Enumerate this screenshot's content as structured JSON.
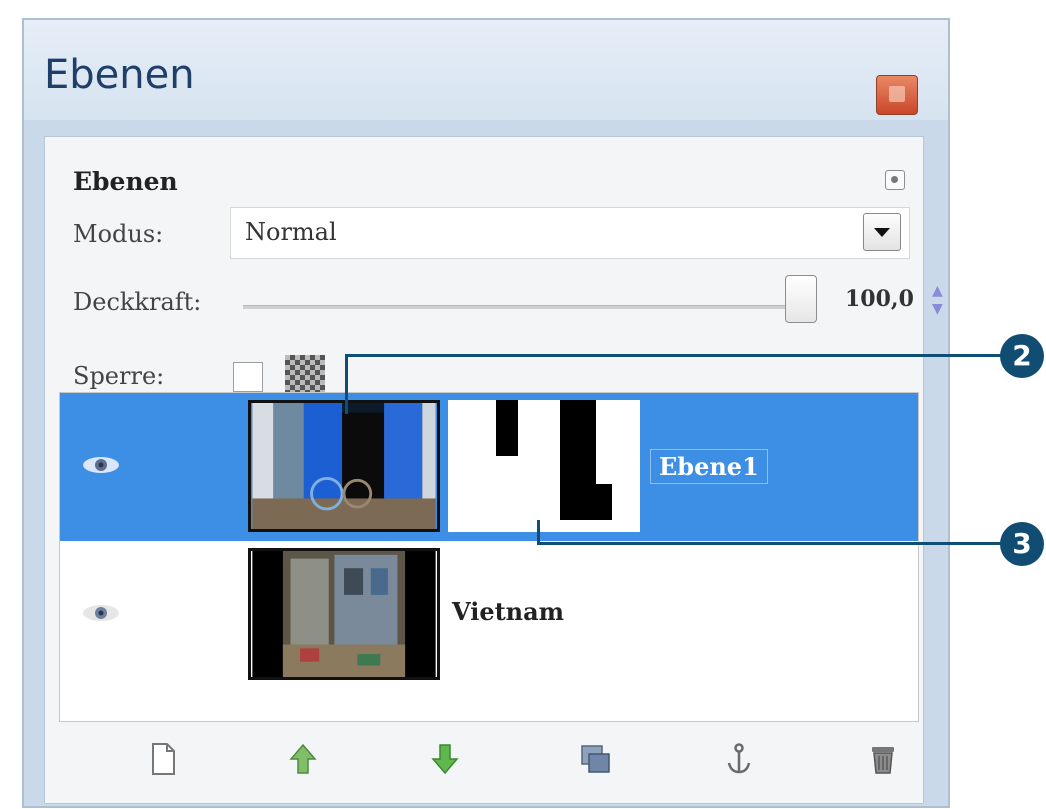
{
  "window": {
    "title": "Ebenen"
  },
  "panel": {
    "heading": "Ebenen",
    "mode_label": "Modus:",
    "mode_value": "Normal",
    "opacity_label": "Deckkraft:",
    "opacity_value": "100,0",
    "opacity_percent": 100,
    "lock_label": "Sperre:"
  },
  "layers": [
    {
      "name": "Ebene1",
      "selected": true,
      "has_mask": true,
      "visible": true
    },
    {
      "name": "Vietnam",
      "selected": false,
      "has_mask": false,
      "visible": true
    }
  ],
  "footer_icons": [
    "new-layer-icon",
    "raise-layer-icon",
    "lower-layer-icon",
    "duplicate-layer-icon",
    "anchor-layer-icon",
    "delete-layer-icon"
  ],
  "callouts": [
    "2",
    "3"
  ],
  "colors": {
    "selection": "#3d8fe6",
    "window_frame": "#c9d9ea",
    "callout": "#114d73",
    "raise_arrow": "#7fbf6a",
    "lower_arrow": "#5fb84d"
  }
}
